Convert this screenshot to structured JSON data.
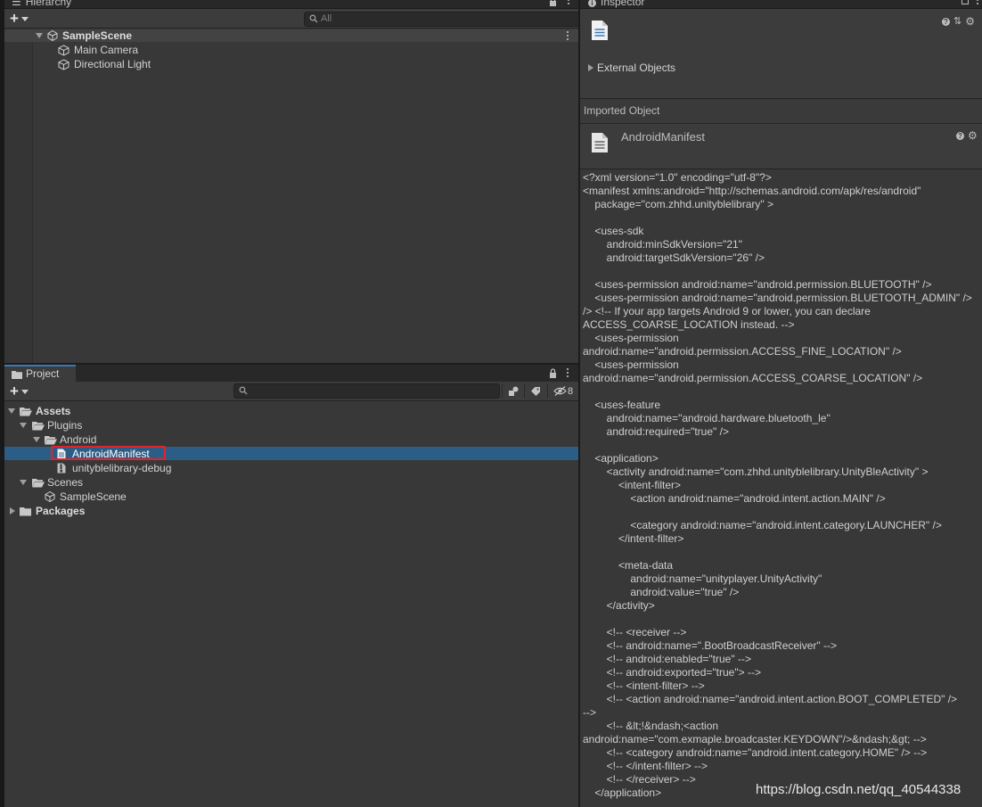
{
  "hierarchy": {
    "tab_label": "Hierarchy",
    "search_placeholder": "All",
    "scene": "SampleScene",
    "items": [
      "Main Camera",
      "Directional Light"
    ]
  },
  "project": {
    "tab_label": "Project",
    "filter_count": "8",
    "tree": {
      "assets": "Assets",
      "plugins": "Plugins",
      "android": "Android",
      "android_manifest": "AndroidManifest",
      "unity_lib": "unityblelibrary-debug",
      "scenes": "Scenes",
      "sample_scene": "SampleScene",
      "packages": "Packages"
    },
    "selected_item": "AndroidManifest"
  },
  "inspector": {
    "tab_label": "Inspector",
    "external_objects": "External Objects",
    "imported_object_label": "Imported Object",
    "asset_name": "AndroidManifest",
    "file_text": "<?xml version=\"1.0\" encoding=\"utf-8\"?>\n<manifest xmlns:android=\"http://schemas.android.com/apk/res/android\"\n    package=\"com.zhhd.unityblelibrary\" >\n\n    <uses-sdk\n        android:minSdkVersion=\"21\"\n        android:targetSdkVersion=\"26\" />\n\n    <uses-permission android:name=\"android.permission.BLUETOOTH\" />\n    <uses-permission android:name=\"android.permission.BLUETOOTH_ADMIN\" />\n/> <!-- If your app targets Android 9 or lower, you can declare\nACCESS_COARSE_LOCATION instead. -->\n    <uses-permission\nandroid:name=\"android.permission.ACCESS_FINE_LOCATION\" />\n    <uses-permission\nandroid:name=\"android.permission.ACCESS_COARSE_LOCATION\" />\n\n    <uses-feature\n        android:name=\"android.hardware.bluetooth_le\"\n        android:required=\"true\" />\n\n    <application>\n        <activity android:name=\"com.zhhd.unityblelibrary.UnityBleActivity\" >\n            <intent-filter>\n                <action android:name=\"android.intent.action.MAIN\" />\n\n                <category android:name=\"android.intent.category.LAUNCHER\" />\n            </intent-filter>\n\n            <meta-data\n                android:name=\"unityplayer.UnityActivity\"\n                android:value=\"true\" />\n        </activity>\n\n        <!-- <receiver -->\n        <!-- android:name=\".BootBroadcastReceiver\" -->\n        <!-- android:enabled=\"true\" -->\n        <!-- android:exported=\"true\"> -->\n        <!-- <intent-filter> -->\n        <!-- <action android:name=\"android.intent.action.BOOT_COMPLETED\" />\n-->\n        <!-- &lt;!&ndash;<action\nandroid:name=\"com.exmaple.broadcaster.KEYDOWN\"/>&ndash;&gt; -->\n        <!-- <category android:name=\"android.intent.category.HOME\" /> -->\n        <!-- </intent-filter> -->\n        <!-- </receiver> -->\n    </application>"
  },
  "watermark": "https://blog.csdn.net/qq_40544338",
  "colors": {
    "selection": "#2c5d87",
    "highlight_border": "#e0242a",
    "tab_accent": "#3a79bb"
  }
}
